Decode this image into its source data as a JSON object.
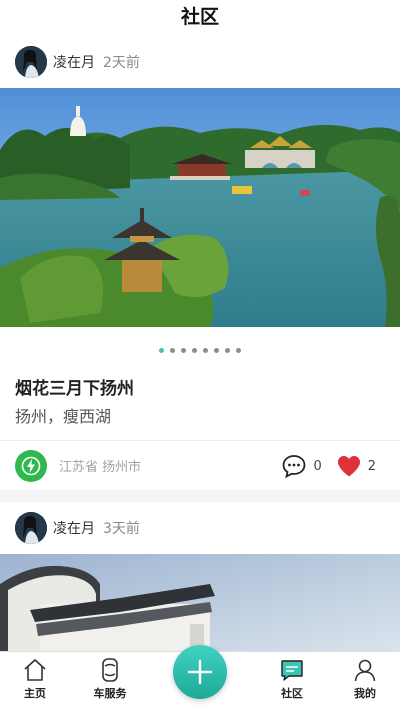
{
  "header": {
    "title": "社区"
  },
  "posts": [
    {
      "user": "凌在月",
      "time": "2天前",
      "title": "烟花三月下扬州",
      "subtitle": "扬州，瘦西湖",
      "location": "江苏省 扬州市",
      "comments": "0",
      "likes": "2",
      "carousel": {
        "count": 8,
        "active": 1
      }
    },
    {
      "user": "凌在月",
      "time": "3天前"
    }
  ],
  "tabbar": {
    "home": "主页",
    "car_service": "车服务",
    "community": "社区",
    "mine": "我的"
  },
  "colors": {
    "accent": "#3cc4b4",
    "like": "#e0303a",
    "location": "#2fb84f"
  }
}
